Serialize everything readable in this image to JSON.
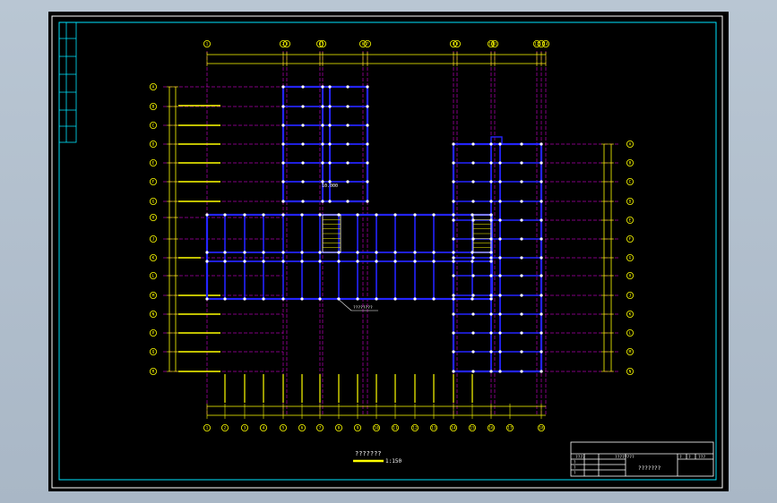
{
  "colors": {
    "background": "#000000",
    "outer_border": "#ffffff",
    "inner_border": "#00e5ff",
    "walls": "#2424ff",
    "dimension_lines": "#ffff00",
    "axis_lines": "#ff00ff",
    "column_markers": "#ffffff",
    "titleblock_lines": "#ffffff"
  },
  "drawing": {
    "scale_label": "1:150",
    "title_label": "???????",
    "room_label": "10.000",
    "stair_callout": "????????"
  },
  "title_block": {
    "project_label": "???????",
    "header_left": "????",
    "header_mid": "????????",
    "header_right_1": "?",
    "header_right_2": "?",
    "header_right_3": "???",
    "row_labels": [
      "?",
      "?",
      "?",
      "?"
    ]
  },
  "top_axes": [
    "1",
    "2",
    "3",
    "4",
    "5",
    "6",
    "7",
    "8",
    "9",
    "10",
    "11",
    "12",
    "13",
    "14"
  ],
  "bottom_axes": [
    "1",
    "2",
    "3",
    "4",
    "5",
    "6",
    "7",
    "8",
    "9",
    "10",
    "11",
    "12",
    "13",
    "14",
    "15",
    "16",
    "17",
    "18"
  ],
  "left_axes": [
    "A",
    "B",
    "C",
    "D",
    "E",
    "F",
    "G",
    "H",
    "J",
    "K",
    "L",
    "M",
    "N",
    "P",
    "Q",
    "R"
  ],
  "right_axes": [
    "A",
    "B",
    "C",
    "D",
    "E",
    "F",
    "G",
    "H",
    "J",
    "K",
    "L",
    "M",
    "N"
  ]
}
